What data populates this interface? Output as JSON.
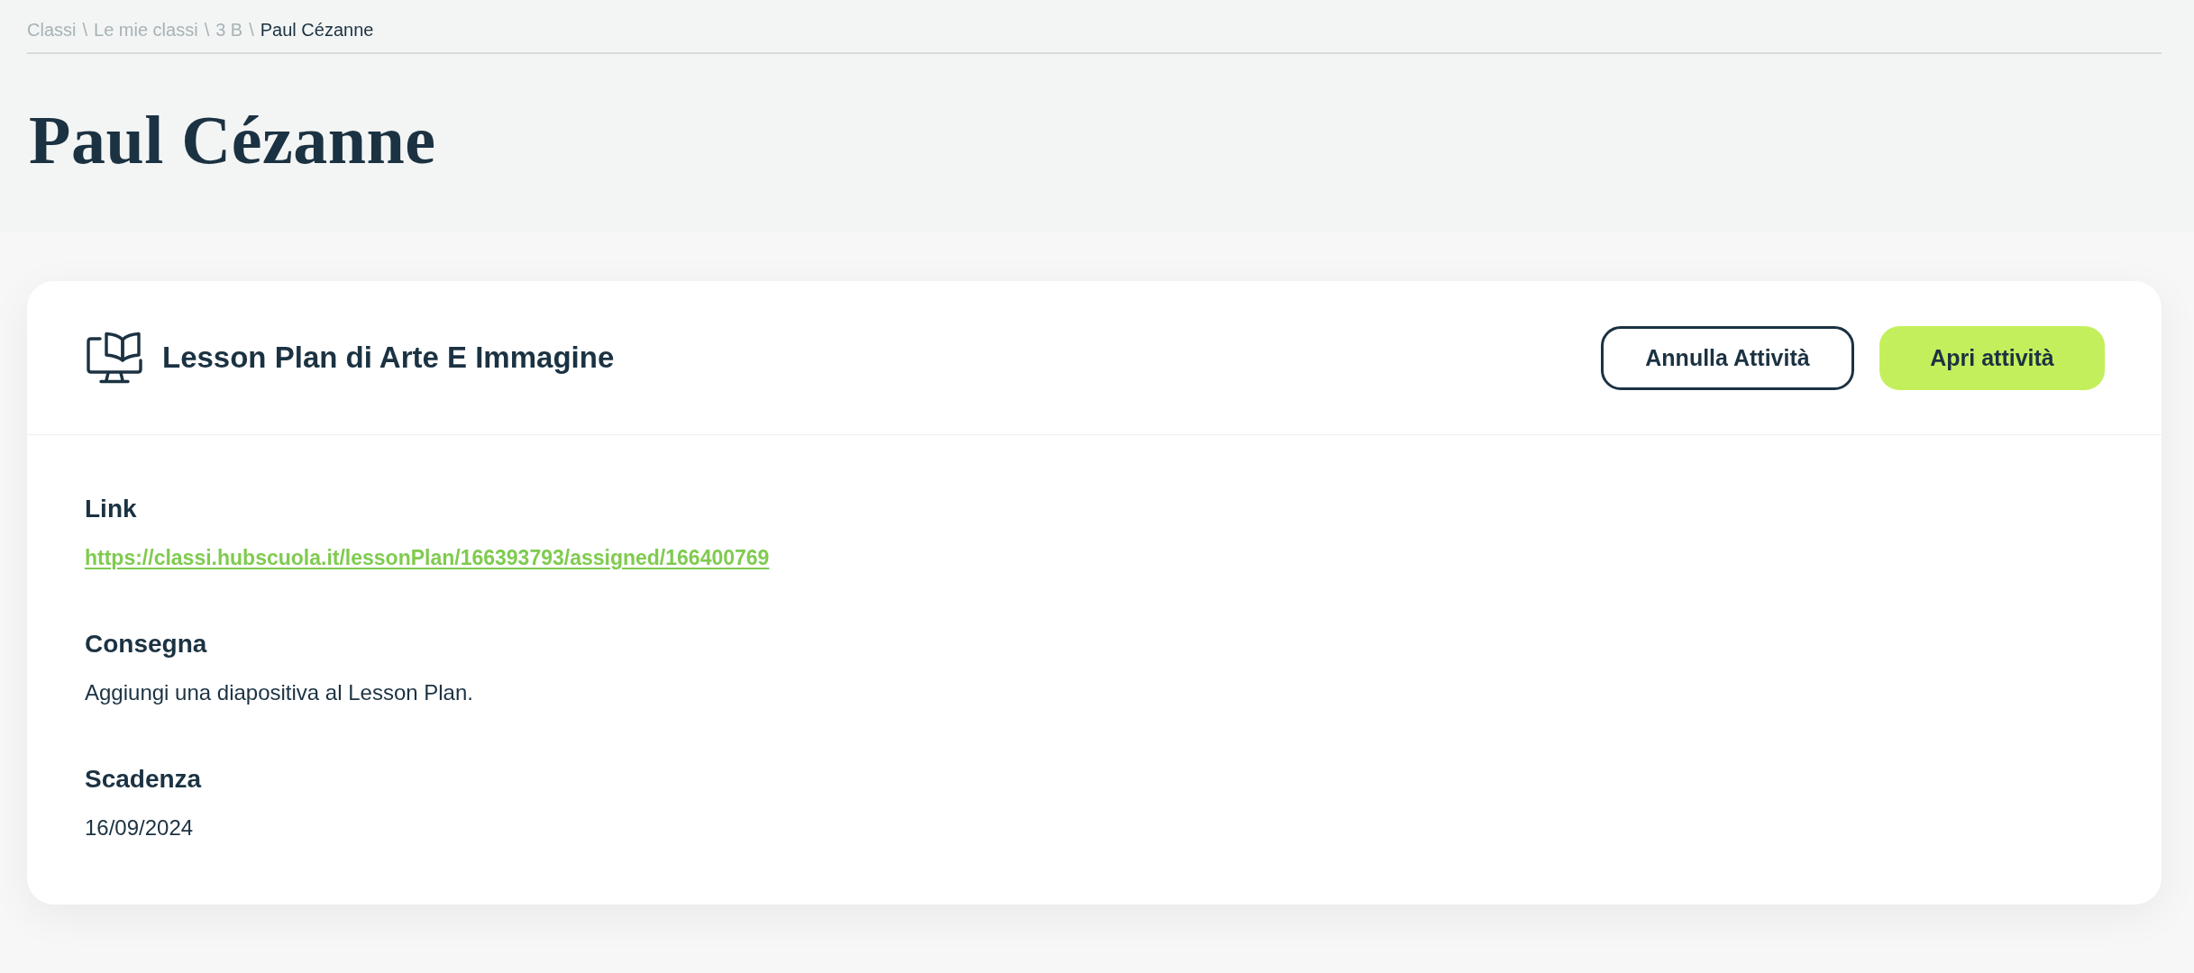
{
  "breadcrumb": {
    "items": [
      {
        "label": "Classi",
        "current": false
      },
      {
        "label": "Le mie classi",
        "current": false
      },
      {
        "label": "3 B",
        "current": false
      },
      {
        "label": "Paul Cézanne",
        "current": true
      }
    ],
    "separators": [
      "\\",
      "\\",
      "\\"
    ]
  },
  "page_title": "Paul Cézanne",
  "activity": {
    "title": "Lesson Plan di Arte E Immagine",
    "buttons": [
      {
        "label": "Annulla Attività",
        "kind": "outline"
      },
      {
        "label": "Apri attività",
        "kind": "primary"
      }
    ],
    "fields": [
      {
        "label": "Link",
        "value": "https://classi.hubscuola.it/lessonPlan/166393793/assigned/166400769",
        "kind": "link"
      },
      {
        "label": "Consegna",
        "value": "Aggiungi una diapositiva al Lesson Plan.",
        "kind": "text"
      },
      {
        "label": "Scadenza",
        "value": "16/09/2024",
        "kind": "text"
      }
    ]
  }
}
